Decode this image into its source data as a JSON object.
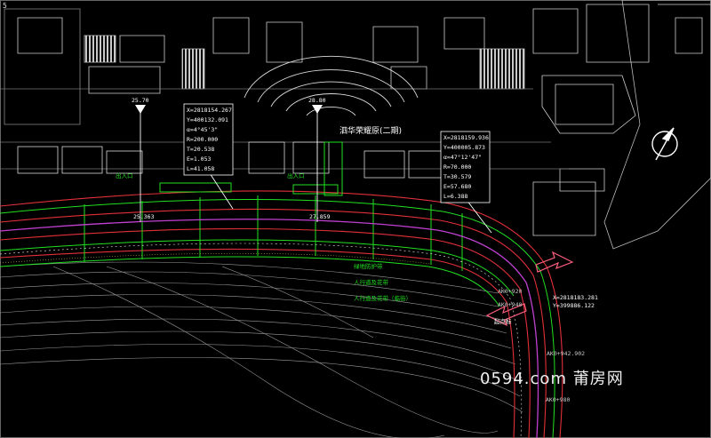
{
  "corner_label": "5",
  "project_name": "泗华荣耀原(二期)",
  "labels": {
    "pk_left": "25.70",
    "pk_mid": "28.80",
    "elev_left": "25.363",
    "elev_mid": "27.859",
    "entry_left": "出入口",
    "entry_left_b": "出入口",
    "entry_mid": "出入口",
    "side_note1": "绿地防护带",
    "side_note2": "人行道及花带",
    "side_note3": "人行道及花带（临街）",
    "station_a": "AK0+942.902",
    "station_b": "AK0+980",
    "station_c": "AK0+940",
    "station_d": "AK0+920",
    "start_label": "起点标",
    "coord_end": "X=2818183.281",
    "coord_end2": "Y=399886.122"
  },
  "curve1": {
    "x": "X=2818154.267",
    "y": "Y=400132.091",
    "alpha": "α=4°45'3\"",
    "r": "R=200.000",
    "t": "T=20.538",
    "e": "E=1.053",
    "l": "L=41.058"
  },
  "curve2": {
    "x": "X=2818159.936",
    "y": "Y=400005.873",
    "alpha": "α=47°12'47\"",
    "r": "R=70.000",
    "t": "T=30.579",
    "e": "E=57.680",
    "l": "L=6.388"
  },
  "watermark": "0594.com 莆房网",
  "colors": {
    "background": "#000000",
    "road_red": "#e0303a",
    "green": "#22e022",
    "magenta": "#c040d0",
    "white": "#e8e8e8",
    "gray": "#9a9a9a"
  }
}
